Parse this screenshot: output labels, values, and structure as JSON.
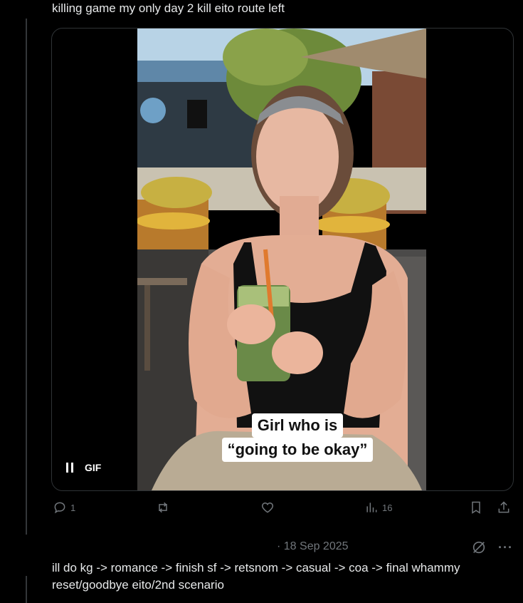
{
  "tweet1": {
    "text": "killing game my only day 2 kill eito route left",
    "media": {
      "gif_label": "GIF",
      "caption_line1": "Girl who is",
      "caption_line2": "“going to be okay”"
    },
    "actions": {
      "reply_count": "1",
      "retweet_count": "",
      "like_count": "",
      "views_count": "16"
    }
  },
  "tweet2": {
    "date": "· 18 Sep 2025",
    "text": "ill do kg -> romance -> finish sf -> retsnom -> casual -> coa -> final whammy reset/goodbye eito/2nd scenario"
  },
  "icons": [
    "reply-icon",
    "retweet-icon",
    "like-icon",
    "views-icon",
    "bookmark-icon",
    "share-icon",
    "grok-icon",
    "more-icon",
    "pause-icon"
  ]
}
